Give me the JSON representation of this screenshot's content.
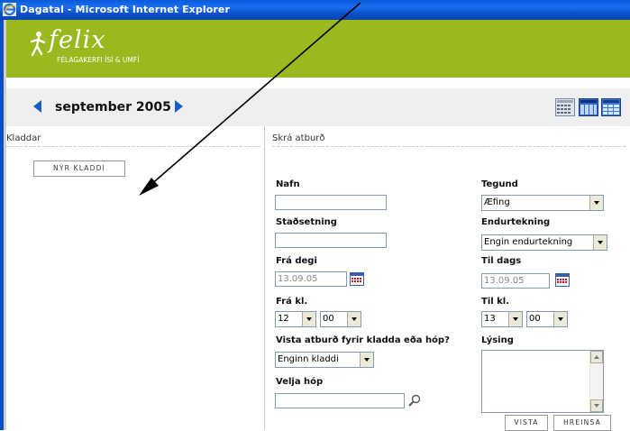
{
  "window": {
    "title": "Dagatal - Microsoft Internet Explorer"
  },
  "brand": {
    "name": "felix",
    "tagline": "FÉLAGAKERFI ÍSÍ & UMFÍ",
    "header_color": "#9bb81e"
  },
  "calendar_nav": {
    "month_label": "september 2005",
    "prev_icon": "arrow-left-icon",
    "next_icon": "arrow-right-icon",
    "view_icons": [
      "month-view-icon",
      "week-view-icon",
      "day-view-icon"
    ]
  },
  "drafts": {
    "title": "Kladdar",
    "new_draft_button": "NÝR KLADDI"
  },
  "event_form": {
    "title": "Skrá atburð",
    "name_label": "Nafn",
    "name_value": "",
    "type_label": "Tegund",
    "type_value": "Æfing",
    "location_label": "Staðsetning",
    "location_value": "",
    "recurrence_label": "Endurtekning",
    "recurrence_value": "Engin endurtekning",
    "from_date_label": "Frá degi",
    "from_date_value": "13.09.05",
    "to_date_label": "Til dags",
    "to_date_value": "13.09.05",
    "from_time_label": "Frá kl.",
    "from_hour": "12",
    "from_min": "00",
    "to_time_label": "Til kl.",
    "to_hour": "13",
    "to_min": "00",
    "show_for_label": "Vista atburð fyrir kladda eða hóp?",
    "show_for_value": "Enginn kladdi",
    "description_label": "Lýsing",
    "group_label": "Velja hóp",
    "group_value": "",
    "save_button": "VISTA",
    "clear_button": "HREINSA"
  }
}
